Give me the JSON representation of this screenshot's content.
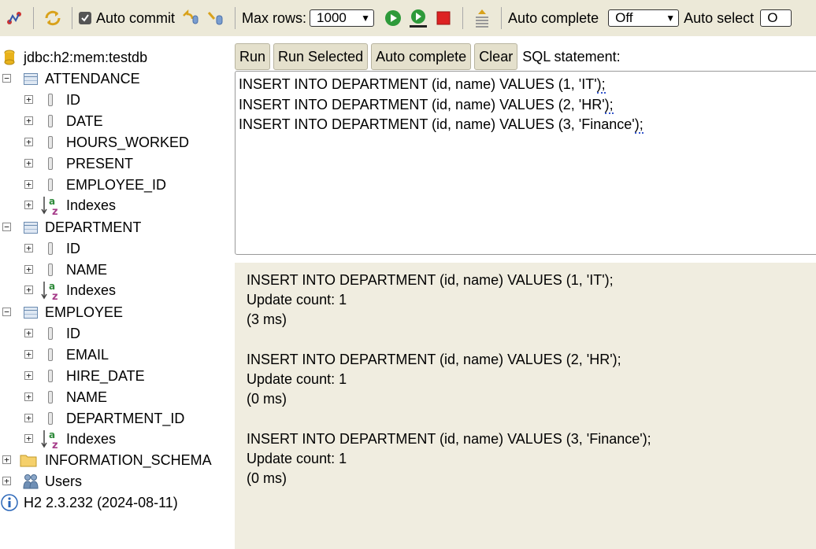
{
  "toolbar": {
    "auto_commit_label": "Auto commit",
    "max_rows_label": "Max rows:",
    "max_rows_value": "1000",
    "auto_complete_label": "Auto complete",
    "auto_complete_value": "Off",
    "auto_select_label": "Auto select",
    "auto_select_value": "O"
  },
  "tree": {
    "connection": "jdbc:h2:mem:testdb",
    "tables": [
      {
        "name": "ATTENDANCE",
        "columns": [
          "ID",
          "DATE",
          "HOURS_WORKED",
          "PRESENT",
          "EMPLOYEE_ID"
        ],
        "indexes": "Indexes"
      },
      {
        "name": "DEPARTMENT",
        "columns": [
          "ID",
          "NAME"
        ],
        "indexes": "Indexes"
      },
      {
        "name": "EMPLOYEE",
        "columns": [
          "ID",
          "EMAIL",
          "HIRE_DATE",
          "NAME",
          "DEPARTMENT_ID"
        ],
        "indexes": "Indexes"
      }
    ],
    "information_schema": "INFORMATION_SCHEMA",
    "users": "Users",
    "version": "H2 2.3.232 (2024-08-11)"
  },
  "buttons": {
    "run": "Run",
    "run_selected": "Run Selected",
    "auto_complete": "Auto complete",
    "clear": "Clear",
    "sql_statement_label": "SQL statement:"
  },
  "editor": {
    "lines": [
      {
        "text": "INSERT INTO DEPARTMENT (id, name) VALUES (1, 'IT'",
        "tail": ");"
      },
      {
        "text": "INSERT INTO DEPARTMENT (id, name) VALUES (2, 'HR'",
        "tail": ");"
      },
      {
        "text": "INSERT INTO DEPARTMENT (id, name) VALUES (3, 'Finance'",
        "tail": ");"
      }
    ]
  },
  "results": [
    {
      "statement": "INSERT INTO DEPARTMENT (id, name) VALUES (1, 'IT');",
      "count": "Update count: 1",
      "time": "(3 ms)"
    },
    {
      "statement": "INSERT INTO DEPARTMENT (id, name) VALUES (2, 'HR');",
      "count": "Update count: 1",
      "time": "(0 ms)"
    },
    {
      "statement": "INSERT INTO DEPARTMENT (id, name) VALUES (3, 'Finance');",
      "count": "Update count: 1",
      "time": "(0 ms)"
    }
  ]
}
